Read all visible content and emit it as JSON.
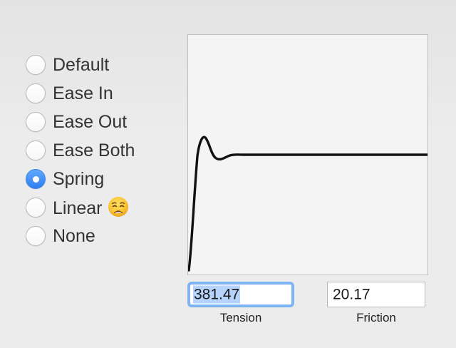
{
  "timing_options": [
    {
      "label": "Default",
      "checked": false
    },
    {
      "label": "Ease In",
      "checked": false
    },
    {
      "label": "Ease Out",
      "checked": false
    },
    {
      "label": "Ease Both",
      "checked": false
    },
    {
      "label": "Spring",
      "checked": true
    },
    {
      "label": "Linear",
      "checked": false,
      "emoji": "weary-face-icon"
    },
    {
      "label": "None",
      "checked": false
    }
  ],
  "curve": {
    "type": "spring",
    "line_color": "#111111",
    "background_color": "#f4f4f4"
  },
  "tension": {
    "value": "381.47",
    "label": "Tension",
    "focused": true,
    "selected": true
  },
  "friction": {
    "value": "20.17",
    "label": "Friction"
  },
  "colors": {
    "accent": "#2f7ef0",
    "focus_ring": "#7fb3f3",
    "selection": "#b6d4fb"
  }
}
